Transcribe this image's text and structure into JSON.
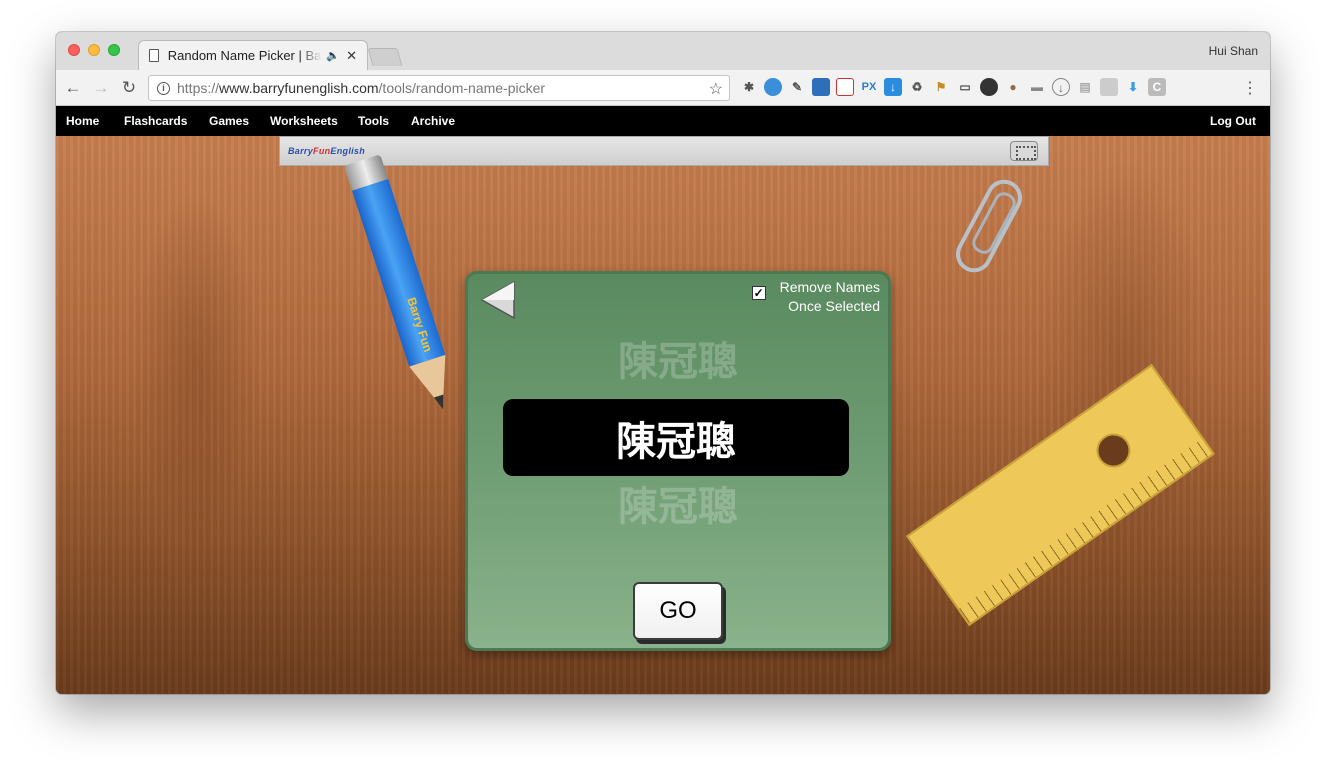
{
  "browser": {
    "tab_title": "Random Name Picker | Barry",
    "tab_audio_icon": "speaker-icon",
    "tab_close": "✕",
    "profile_name": "Hui Shan",
    "url_scheme": "https://",
    "url_host": "www.barryfunenglish.com",
    "url_path": "/tools/random-name-picker",
    "menu": "⋮"
  },
  "site_nav": {
    "items": [
      "Home",
      "Flashcards",
      "Games",
      "Worksheets",
      "Tools",
      "Archive"
    ],
    "logout": "Log Out"
  },
  "banner": {
    "logo_barry": "Barry",
    "logo_fun": "Fun",
    "logo_english": "English"
  },
  "pencil_brand": "Barry Fun",
  "picker": {
    "remove_line1": "Remove Names",
    "remove_line2": "Once Selected",
    "remove_checked": true,
    "checkmark": "✓",
    "ghost_above": "陳冠聰",
    "current_name": "陳冠聰",
    "ghost_below": "陳冠聰",
    "go_label": "GO"
  },
  "colors": {
    "widget_green": "#5a8a5f",
    "nav_bg": "#000000",
    "wood": "#b16a3d"
  }
}
